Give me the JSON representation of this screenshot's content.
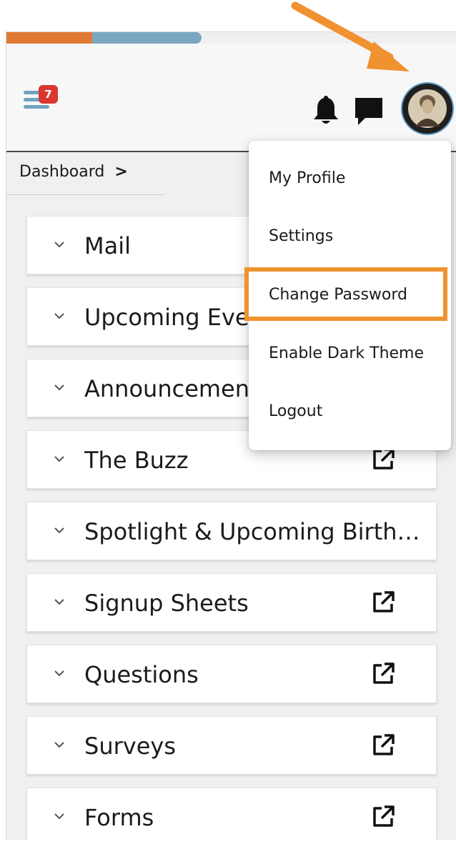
{
  "header": {
    "menu_badge": "7",
    "icons": [
      "menu-icon",
      "bell-icon",
      "chat-icon",
      "avatar"
    ]
  },
  "breadcrumb": {
    "label": "Dashboard",
    "separator": ">"
  },
  "accordions": [
    {
      "title": "Mail",
      "external": false
    },
    {
      "title": "Upcoming Events",
      "external": false
    },
    {
      "title": "Announcements",
      "external": false
    },
    {
      "title": "The Buzz",
      "external": true
    },
    {
      "title": "Spotlight & Upcoming Birthdays",
      "external": false
    },
    {
      "title": "Signup Sheets",
      "external": true
    },
    {
      "title": "Questions",
      "external": true
    },
    {
      "title": "Surveys",
      "external": true
    },
    {
      "title": "Forms",
      "external": true
    }
  ],
  "profile_menu": {
    "items": [
      "My Profile",
      "Settings",
      "Change Password",
      "Enable Dark Theme",
      "Logout"
    ],
    "highlighted": "Change Password"
  },
  "colors": {
    "progress_orange": "#e07a35",
    "progress_blue": "#7ba7c1",
    "badge_red": "#d9372f",
    "highlight_orange": "#f0922f",
    "menu_icon_blue": "#6fa3bf"
  }
}
